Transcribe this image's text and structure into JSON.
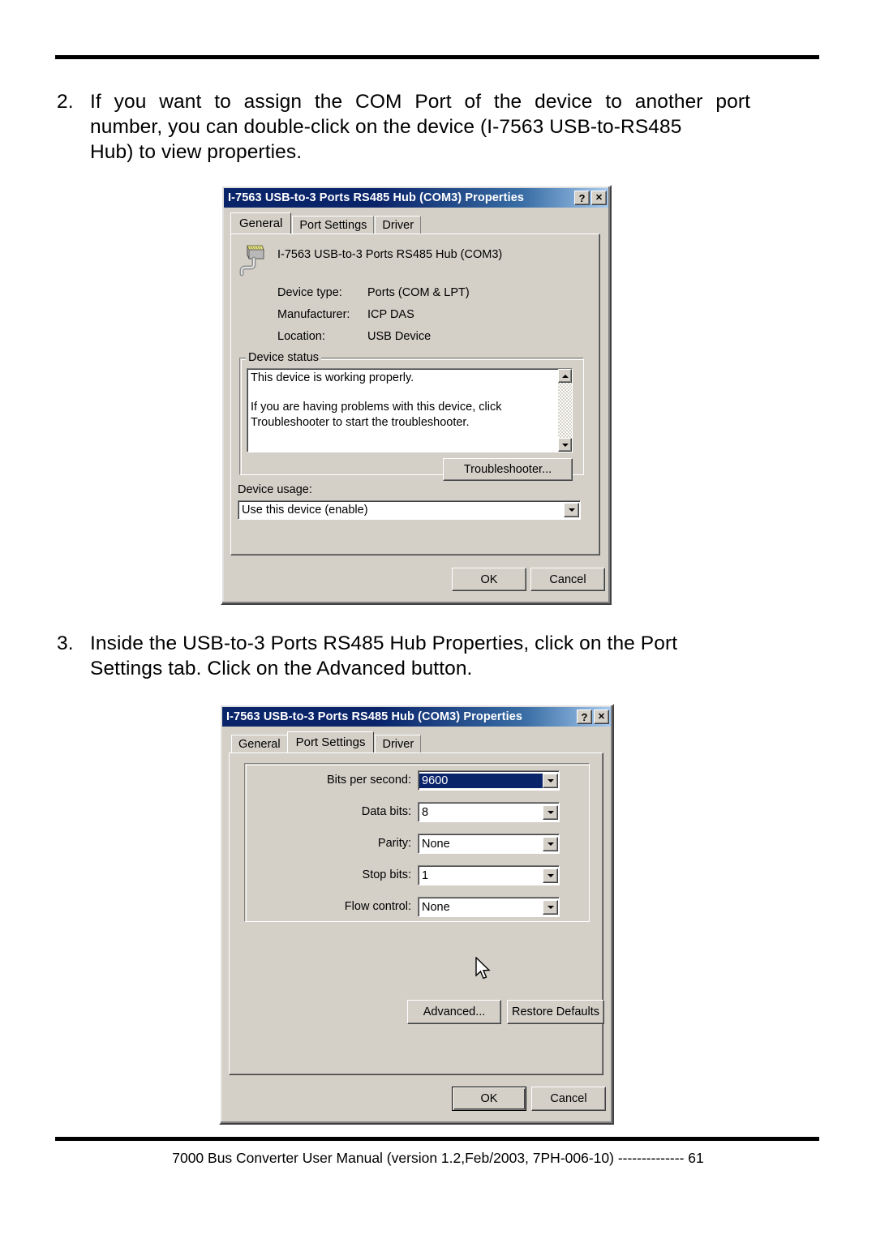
{
  "document": {
    "steps": [
      {
        "number": "2.",
        "line1": "If you want to assign the COM Port of the device to another port",
        "line2": "number, you can double-click on the device (I-7563 USB-to-RS485",
        "line3": "Hub) to view properties."
      },
      {
        "number": "3.",
        "line1": "Inside the USB-to-3 Ports RS485 Hub Properties, click on the Port",
        "line2": "Settings tab. Click on the Advanced button."
      }
    ],
    "footer": "7000 Bus Converter User Manual (version 1.2,Feb/2003, 7PH-006-10) -------------- 61"
  },
  "dialog_general": {
    "title": "I-7563 USB-to-3 Ports RS485 Hub (COM3) Properties",
    "help_button": "?",
    "close_button": "✕",
    "tabs": [
      {
        "label": "General",
        "active": true
      },
      {
        "label": "Port Settings",
        "active": false
      },
      {
        "label": "Driver",
        "active": false
      }
    ],
    "device_name": "I-7563 USB-to-3 Ports RS485 Hub (COM3)",
    "device_icon": "serial-port-icon",
    "fields": [
      {
        "label": "Device type:",
        "value": "Ports (COM & LPT)"
      },
      {
        "label": "Manufacturer:",
        "value": "ICP DAS"
      },
      {
        "label": "Location:",
        "value": "USB Device"
      }
    ],
    "status_group_label": "Device status",
    "status_paragraph_1": "This device is working properly.",
    "status_paragraph_2": "If you are having problems with this device, click Troubleshooter to start the troubleshooter.",
    "troubleshooter_button": "Troubleshooter...",
    "device_usage_label": "Device usage:",
    "device_usage_value": "Use this device (enable)",
    "ok_button": "OK",
    "cancel_button": "Cancel"
  },
  "dialog_port_settings": {
    "title": "I-7563 USB-to-3 Ports RS485 Hub (COM3) Properties",
    "help_button": "?",
    "close_button": "✕",
    "tabs": [
      {
        "label": "General",
        "active": false
      },
      {
        "label": "Port Settings",
        "active": true
      },
      {
        "label": "Driver",
        "active": false
      }
    ],
    "settings": [
      {
        "label": "Bits per second:",
        "value": "9600",
        "selected": true
      },
      {
        "label": "Data bits:",
        "value": "8",
        "selected": false
      },
      {
        "label": "Parity:",
        "value": "None",
        "selected": false
      },
      {
        "label": "Stop bits:",
        "value": "1",
        "selected": false
      },
      {
        "label": "Flow control:",
        "value": "None",
        "selected": false
      }
    ],
    "advanced_button": "Advanced...",
    "restore_defaults_button": "Restore Defaults",
    "ok_button": "OK",
    "cancel_button": "Cancel"
  },
  "colors": {
    "dialog_face": "#d4d0c8",
    "titlebar_start": "#0a246a",
    "titlebar_end": "#a6caf0",
    "selection": "#0a246a",
    "text": "#000000"
  }
}
